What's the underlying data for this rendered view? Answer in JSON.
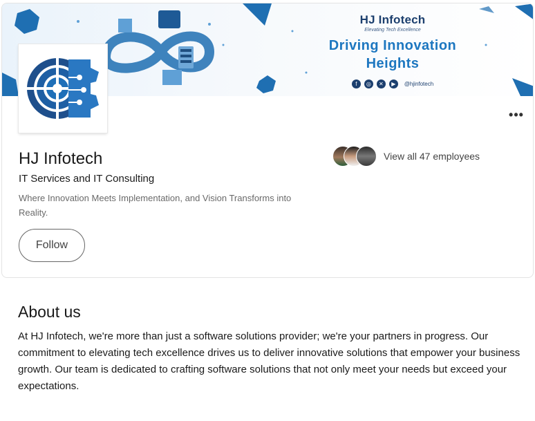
{
  "banner": {
    "brand_name": "HJ Infotech",
    "brand_tagline": "Elevating Tech Excellence",
    "headline_line1": "Driving Innovation",
    "headline_line2": "Heights",
    "social_icons": [
      "facebook-icon",
      "instagram-icon",
      "x-icon",
      "youtube-icon"
    ],
    "social_handle": "@hjinfotech"
  },
  "company": {
    "name": "HJ Infotech",
    "industry": "IT Services and IT Consulting",
    "tagline": "Where Innovation Meets Implementation, and Vision Transforms into Reality.",
    "follow_label": "Follow",
    "more_label": "•••"
  },
  "employees": {
    "label": "View all 47 employees"
  },
  "about": {
    "title": "About us",
    "text": "At HJ Infotech, we're more than just a software solutions provider; we're your partners in progress. Our commitment to elevating tech excellence drives us to deliver innovative solutions that empower your business growth. Our team is dedicated to crafting software solutions that not only meet your needs but exceed your expectations."
  },
  "colors": {
    "brand_dark": "#1c3f6e",
    "brand_blue": "#1d77c0",
    "accent_light": "#eaf3fb"
  }
}
